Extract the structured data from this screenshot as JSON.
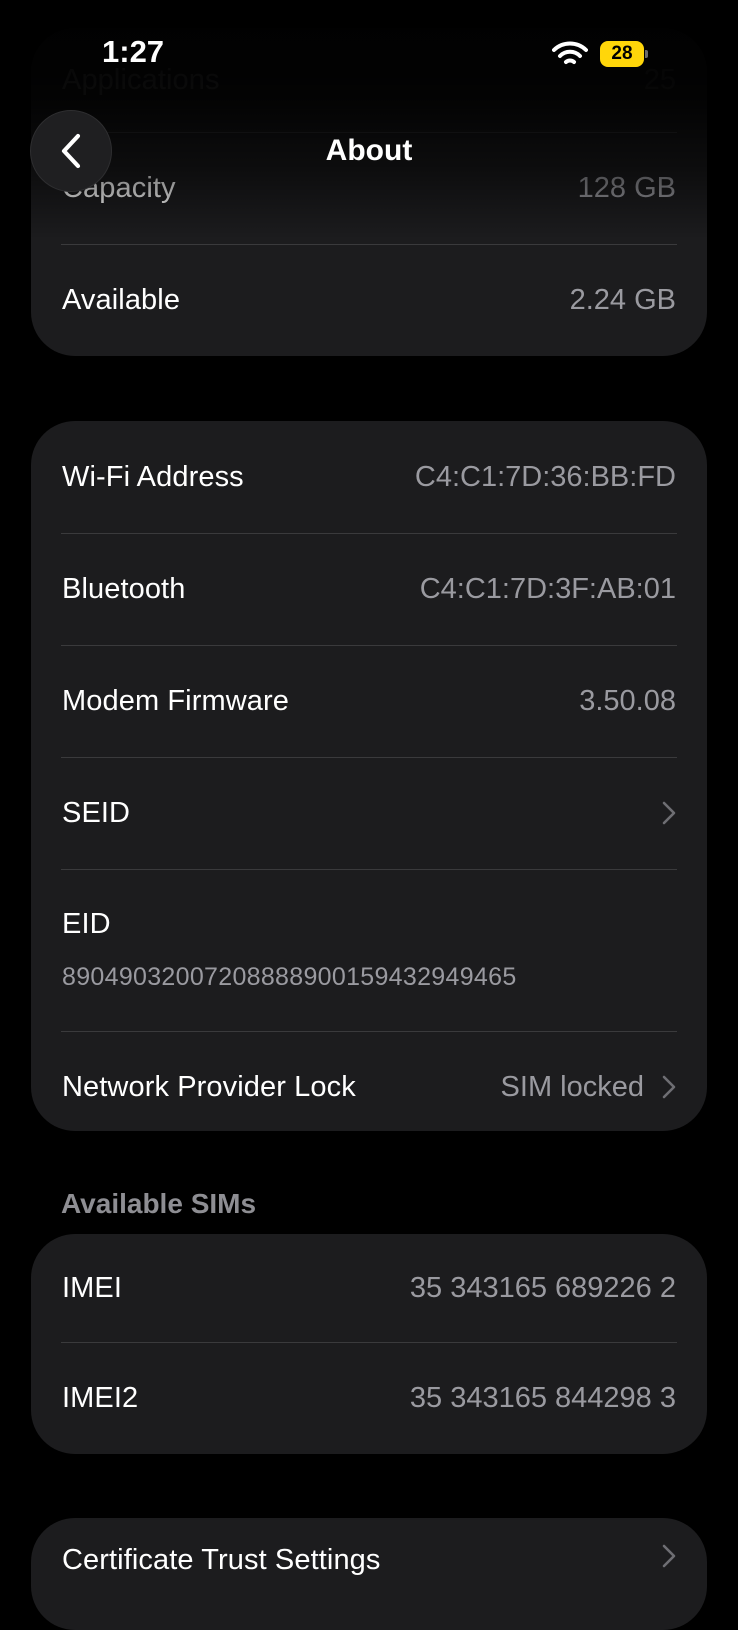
{
  "status_bar": {
    "time": "1:27",
    "battery_level": "28",
    "battery_color": "#ffd60a",
    "wifi_icon": "wifi-icon"
  },
  "nav": {
    "title": "About",
    "back_icon": "chevron-left-icon"
  },
  "storage_card": {
    "rows": [
      {
        "label": "Applications",
        "value": "25"
      },
      {
        "label": "Capacity",
        "value": "128 GB"
      },
      {
        "label": "Available",
        "value": "2.24 GB"
      }
    ]
  },
  "network_card": {
    "rows": [
      {
        "label": "Wi-Fi Address",
        "value": "C4:C1:7D:36:BB:FD"
      },
      {
        "label": "Bluetooth",
        "value": "C4:C1:7D:3F:AB:01"
      },
      {
        "label": "Modem Firmware",
        "value": "3.50.08"
      },
      {
        "label": "SEID",
        "value": ""
      },
      {
        "label": "EID",
        "value": "89049032007208888900159432949465"
      },
      {
        "label": "Network Provider Lock",
        "value": "SIM locked"
      }
    ]
  },
  "sims": {
    "header": "Available SIMs",
    "rows": [
      {
        "label": "IMEI",
        "value": "35 343165 689226 2"
      },
      {
        "label": "IMEI2",
        "value": "35 343165 844298 3"
      }
    ]
  },
  "trust_card": {
    "label": "Certificate Trust Settings"
  },
  "colors": {
    "background": "#000000",
    "card": "#1c1c1e",
    "separator": "#3a3a3c",
    "secondary_text": "#9a9aa0",
    "section_header": "#8e8e93"
  }
}
